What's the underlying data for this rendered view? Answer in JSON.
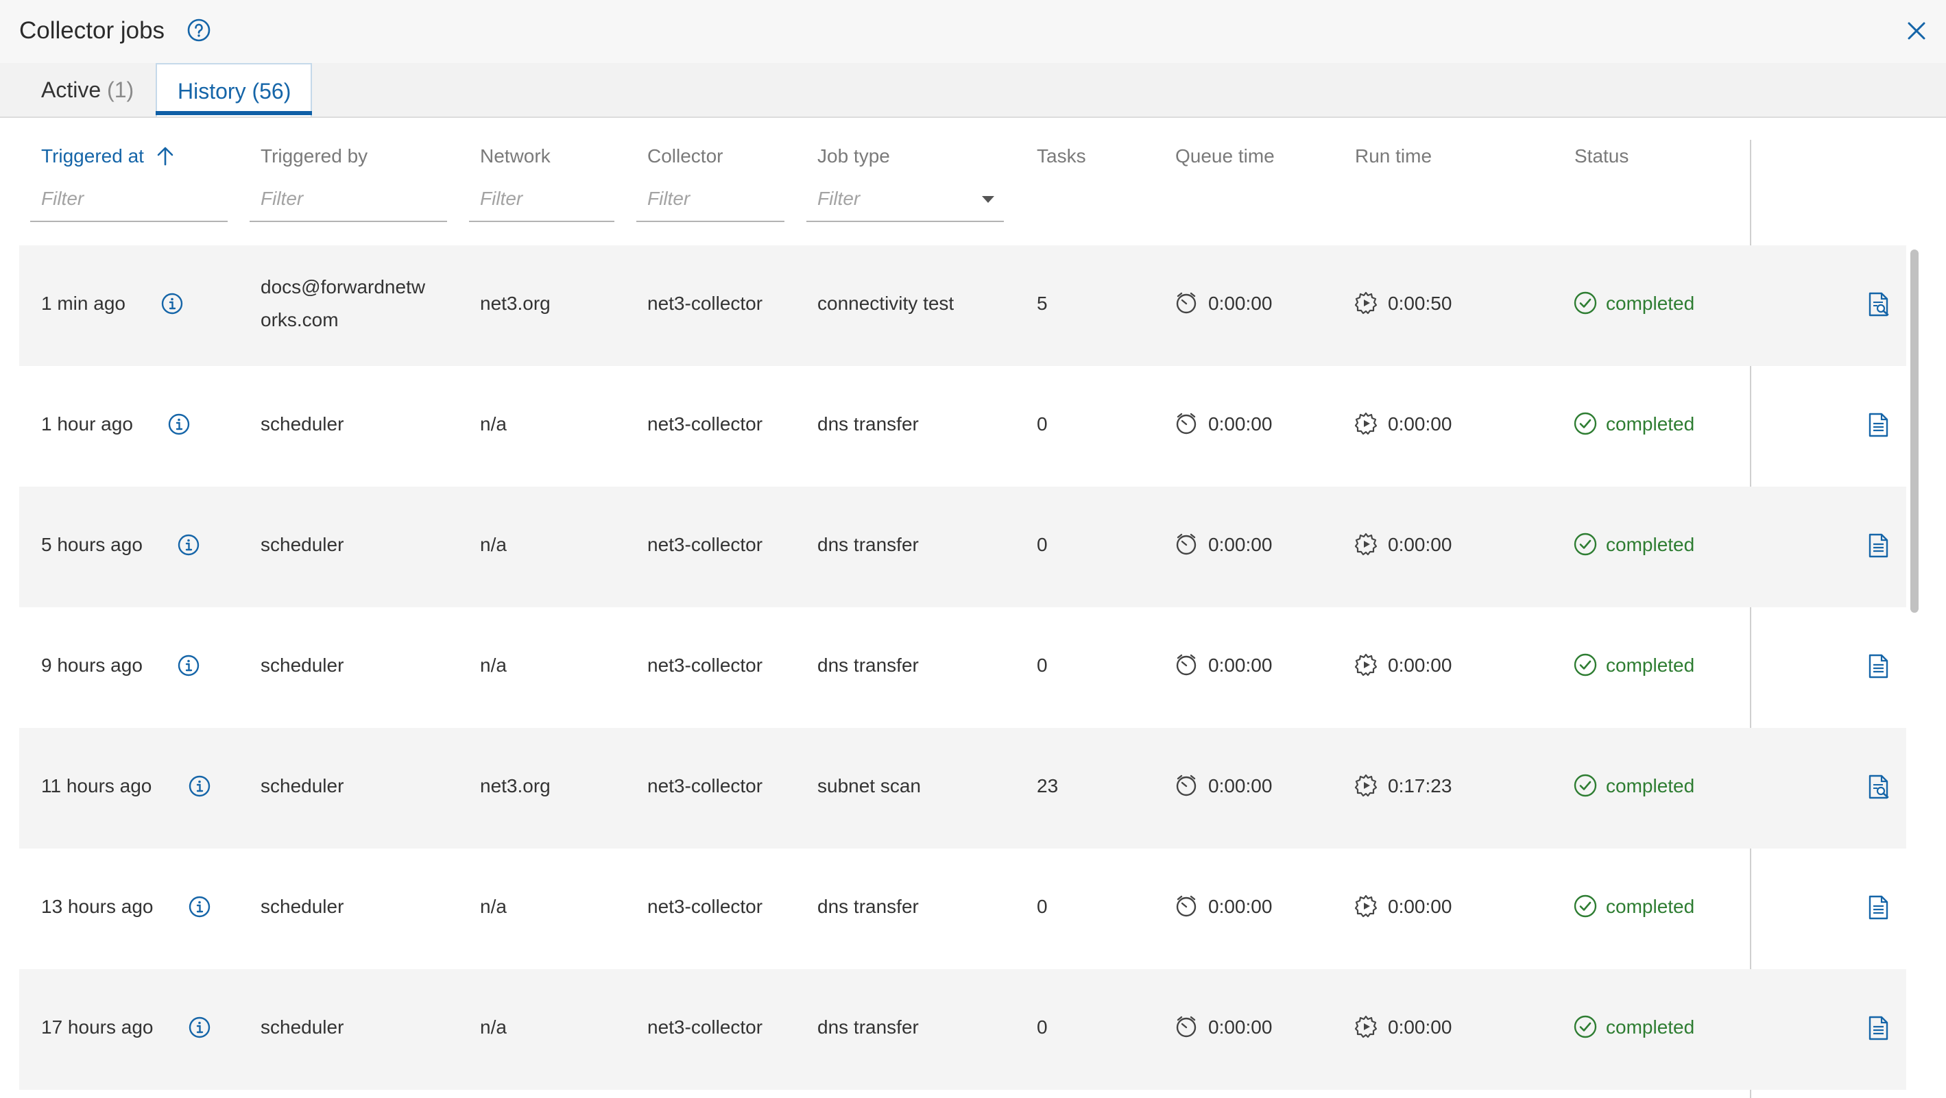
{
  "dialog": {
    "title": "Collector jobs",
    "help_icon": "help-circle-icon",
    "close_icon": "close-icon"
  },
  "tabs": [
    {
      "label": "Active",
      "count": "(1)",
      "active": false
    },
    {
      "label": "History",
      "count": "(56)",
      "active": true
    }
  ],
  "columns": {
    "triggered_at": "Triggered at",
    "triggered_by": "Triggered by",
    "network": "Network",
    "collector": "Collector",
    "job_type": "Job type",
    "tasks": "Tasks",
    "queue_time": "Queue time",
    "run_time": "Run time",
    "status": "Status"
  },
  "sort": {
    "column": "triggered_at",
    "direction": "ascending",
    "icon": "arrow-up-icon"
  },
  "filters": {
    "placeholder": "Filter",
    "job_type_dropdown_icon": "caret-down-icon"
  },
  "rows": [
    {
      "triggered_at": "1 min ago",
      "triggered_by_line1": "docs@forwardnetw",
      "triggered_by_line2": "orks.com",
      "network": "net3.org",
      "collector": "net3-collector",
      "job_type": "connectivity test",
      "tasks": "5",
      "queue_time": "0:00:00",
      "run_time": "0:00:50",
      "status": "completed",
      "action_icon": "document-search-icon"
    },
    {
      "triggered_at": "1 hour ago",
      "triggered_by_line1": "scheduler",
      "triggered_by_line2": "",
      "network": "n/a",
      "collector": "net3-collector",
      "job_type": "dns transfer",
      "tasks": "0",
      "queue_time": "0:00:00",
      "run_time": "0:00:00",
      "status": "completed",
      "action_icon": "document-icon"
    },
    {
      "triggered_at": "5 hours ago",
      "triggered_by_line1": "scheduler",
      "triggered_by_line2": "",
      "network": "n/a",
      "collector": "net3-collector",
      "job_type": "dns transfer",
      "tasks": "0",
      "queue_time": "0:00:00",
      "run_time": "0:00:00",
      "status": "completed",
      "action_icon": "document-icon"
    },
    {
      "triggered_at": "9 hours ago",
      "triggered_by_line1": "scheduler",
      "triggered_by_line2": "",
      "network": "n/a",
      "collector": "net3-collector",
      "job_type": "dns transfer",
      "tasks": "0",
      "queue_time": "0:00:00",
      "run_time": "0:00:00",
      "status": "completed",
      "action_icon": "document-icon"
    },
    {
      "triggered_at": "11 hours ago",
      "triggered_by_line1": "scheduler",
      "triggered_by_line2": "",
      "network": "net3.org",
      "collector": "net3-collector",
      "job_type": "subnet scan",
      "tasks": "23",
      "queue_time": "0:00:00",
      "run_time": "0:17:23",
      "status": "completed",
      "action_icon": "document-search-icon"
    },
    {
      "triggered_at": "13 hours ago",
      "triggered_by_line1": "scheduler",
      "triggered_by_line2": "",
      "network": "n/a",
      "collector": "net3-collector",
      "job_type": "dns transfer",
      "tasks": "0",
      "queue_time": "0:00:00",
      "run_time": "0:00:00",
      "status": "completed",
      "action_icon": "document-icon"
    },
    {
      "triggered_at": "17 hours ago",
      "triggered_by_line1": "scheduler",
      "triggered_by_line2": "",
      "network": "n/a",
      "collector": "net3-collector",
      "job_type": "dns transfer",
      "tasks": "0",
      "queue_time": "0:00:00",
      "run_time": "0:00:00",
      "status": "completed",
      "action_icon": "document-icon"
    }
  ],
  "colors": {
    "accent": "#1565a8",
    "status_completed": "#2e7d32",
    "row_shade": "#f4f4f4"
  }
}
